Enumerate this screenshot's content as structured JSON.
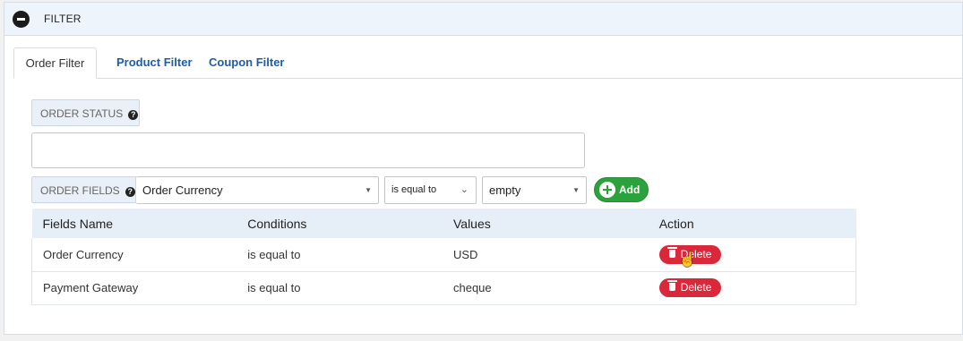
{
  "panel": {
    "title": "FILTER"
  },
  "tabs": [
    {
      "label": "Order Filter",
      "active": true
    },
    {
      "label": "Product Filter",
      "active": false
    },
    {
      "label": "Coupon Filter",
      "active": false
    }
  ],
  "order_status": {
    "label": "ORDER STATUS",
    "help_icon": "question-icon",
    "value": ""
  },
  "order_fields": {
    "label": "ORDER FIELDS",
    "help_icon": "question-icon",
    "field_selected": "Order Currency",
    "condition_selected": "is equal to",
    "value_selected": "empty",
    "add_label": "Add"
  },
  "table": {
    "headers": [
      "Fields Name",
      "Conditions",
      "Values",
      "Action"
    ],
    "rows": [
      {
        "field": "Order Currency",
        "condition": "is equal to",
        "value": "USD",
        "action": "Delete"
      },
      {
        "field": "Payment Gateway",
        "condition": "is equal to",
        "value": "cheque",
        "action": "Delete"
      }
    ]
  },
  "colors": {
    "header_bg": "#eef4fb",
    "tab_link": "#1c5ea8",
    "add_green": "#2ba23c",
    "delete_red": "#d8283a"
  }
}
